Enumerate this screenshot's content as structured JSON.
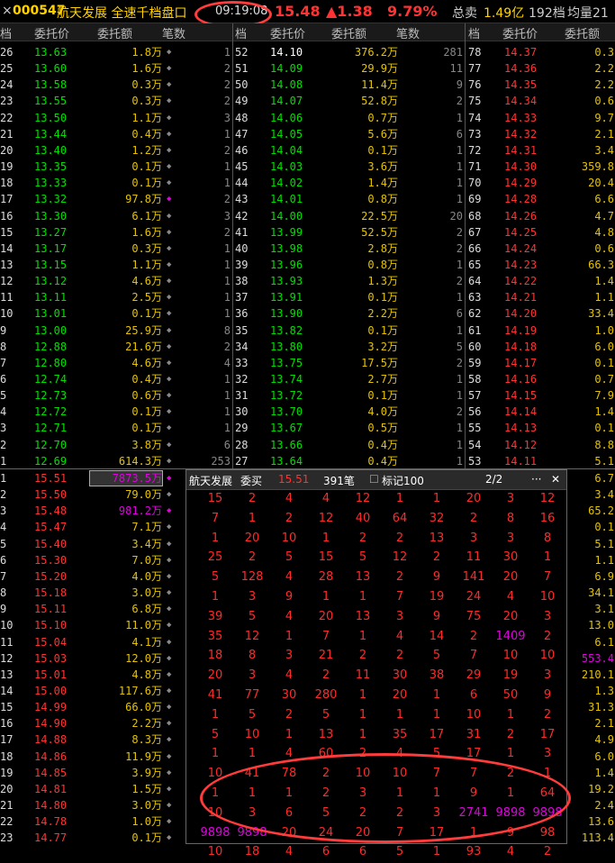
{
  "title": {
    "close": "×",
    "code": "000547",
    "name": "航天发展 全速千档盘口",
    "time": "09:19:08",
    "price": "15.48",
    "change": "▲1.38",
    "pct": "9.79%",
    "turnover_label": "总卖",
    "turnover_value": "1.49亿",
    "levels": "192档",
    "avg_label": "均量21"
  },
  "colors": {
    "up": "#ff3333",
    "down": "#00e000",
    "amount": "#e6c300",
    "flat": "#ffffff",
    "magenta": "#e000e0"
  },
  "header": [
    "档",
    "委托价",
    "委托额",
    "笔数",
    "档",
    "委托价",
    "委托额",
    "笔数",
    "档",
    "委托价",
    "委托额"
  ],
  "sell_left": [
    [
      "26",
      "13.63",
      "1.8万",
      "1"
    ],
    [
      "25",
      "13.60",
      "1.6万",
      "2"
    ],
    [
      "24",
      "13.58",
      "0.3万",
      "2"
    ],
    [
      "23",
      "13.55",
      "0.3万",
      "2"
    ],
    [
      "22",
      "13.50",
      "1.1万",
      "3"
    ],
    [
      "21",
      "13.44",
      "0.4万",
      "1"
    ],
    [
      "20",
      "13.40",
      "1.2万",
      "2"
    ],
    [
      "19",
      "13.35",
      "0.1万",
      "1"
    ],
    [
      "18",
      "13.33",
      "0.1万",
      "1"
    ],
    [
      "17",
      "13.32",
      "97.8万",
      "2"
    ],
    [
      "16",
      "13.30",
      "6.1万",
      "3"
    ],
    [
      "15",
      "13.27",
      "1.6万",
      "2"
    ],
    [
      "14",
      "13.17",
      "0.3万",
      "1"
    ],
    [
      "13",
      "13.15",
      "1.1万",
      "1"
    ],
    [
      "12",
      "13.12",
      "4.6万",
      "1"
    ],
    [
      "11",
      "13.11",
      "2.5万",
      "1"
    ],
    [
      "10",
      "13.01",
      "0.1万",
      "1"
    ],
    [
      "9",
      "13.00",
      "25.9万",
      "8"
    ],
    [
      "8",
      "12.88",
      "21.6万",
      "2"
    ],
    [
      "7",
      "12.80",
      "4.6万",
      "4"
    ],
    [
      "6",
      "12.74",
      "0.4万",
      "1"
    ],
    [
      "5",
      "12.73",
      "0.6万",
      "1"
    ],
    [
      "4",
      "12.72",
      "0.1万",
      "1"
    ],
    [
      "3",
      "12.71",
      "0.1万",
      "1"
    ],
    [
      "2",
      "12.70",
      "3.8万",
      "6"
    ],
    [
      "1",
      "12.69",
      "614.3万",
      "253"
    ]
  ],
  "sell_mid": [
    [
      "52",
      "14.10",
      "376.2万",
      "281"
    ],
    [
      "51",
      "14.09",
      "29.9万",
      "11"
    ],
    [
      "50",
      "14.08",
      "11.4万",
      "9"
    ],
    [
      "49",
      "14.07",
      "52.8万",
      "2"
    ],
    [
      "48",
      "14.06",
      "0.7万",
      "1"
    ],
    [
      "47",
      "14.05",
      "5.6万",
      "6"
    ],
    [
      "46",
      "14.04",
      "0.1万",
      "1"
    ],
    [
      "45",
      "14.03",
      "3.6万",
      "1"
    ],
    [
      "44",
      "14.02",
      "1.4万",
      "1"
    ],
    [
      "43",
      "14.01",
      "0.8万",
      "1"
    ],
    [
      "42",
      "14.00",
      "22.5万",
      "20"
    ],
    [
      "41",
      "13.99",
      "52.5万",
      "2"
    ],
    [
      "40",
      "13.98",
      "2.8万",
      "2"
    ],
    [
      "39",
      "13.96",
      "0.8万",
      "1"
    ],
    [
      "38",
      "13.93",
      "1.3万",
      "2"
    ],
    [
      "37",
      "13.91",
      "0.1万",
      "1"
    ],
    [
      "36",
      "13.90",
      "2.2万",
      "6"
    ],
    [
      "35",
      "13.82",
      "0.1万",
      "1"
    ],
    [
      "34",
      "13.80",
      "3.2万",
      "5"
    ],
    [
      "33",
      "13.75",
      "17.5万",
      "2"
    ],
    [
      "32",
      "13.74",
      "2.7万",
      "1"
    ],
    [
      "31",
      "13.72",
      "0.1万",
      "1"
    ],
    [
      "30",
      "13.70",
      "4.0万",
      "2"
    ],
    [
      "29",
      "13.67",
      "0.5万",
      "1"
    ],
    [
      "28",
      "13.66",
      "0.4万",
      "1"
    ],
    [
      "27",
      "13.64",
      "0.4万",
      "1"
    ]
  ],
  "sell_right": [
    [
      "78",
      "14.37",
      "0.3"
    ],
    [
      "77",
      "14.36",
      "2.2"
    ],
    [
      "76",
      "14.35",
      "2.2"
    ],
    [
      "75",
      "14.34",
      "0.6"
    ],
    [
      "74",
      "14.33",
      "9.7"
    ],
    [
      "73",
      "14.32",
      "2.1"
    ],
    [
      "72",
      "14.31",
      "3.4"
    ],
    [
      "71",
      "14.30",
      "359.8"
    ],
    [
      "70",
      "14.29",
      "20.4"
    ],
    [
      "69",
      "14.28",
      "6.6"
    ],
    [
      "68",
      "14.26",
      "4.7"
    ],
    [
      "67",
      "14.25",
      "4.8"
    ],
    [
      "66",
      "14.24",
      "0.6"
    ],
    [
      "65",
      "14.23",
      "66.3"
    ],
    [
      "64",
      "14.22",
      "1.4"
    ],
    [
      "63",
      "14.21",
      "1.1"
    ],
    [
      "62",
      "14.20",
      "33.4"
    ],
    [
      "61",
      "14.19",
      "1.0"
    ],
    [
      "60",
      "14.18",
      "6.0"
    ],
    [
      "59",
      "14.17",
      "0.1"
    ],
    [
      "58",
      "14.16",
      "0.7"
    ],
    [
      "57",
      "14.15",
      "7.9"
    ],
    [
      "56",
      "14.14",
      "1.4"
    ],
    [
      "55",
      "14.13",
      "0.1"
    ],
    [
      "54",
      "14.12",
      "8.8"
    ],
    [
      "53",
      "14.11",
      "5.1"
    ]
  ],
  "buy_left": [
    [
      "1",
      "15.51",
      "7873.5万"
    ],
    [
      "2",
      "15.50",
      "79.0万"
    ],
    [
      "3",
      "15.48",
      "981.2万"
    ],
    [
      "4",
      "15.47",
      "7.1万"
    ],
    [
      "5",
      "15.40",
      "3.4万"
    ],
    [
      "6",
      "15.30",
      "7.0万"
    ],
    [
      "7",
      "15.20",
      "4.0万"
    ],
    [
      "8",
      "15.18",
      "3.0万"
    ],
    [
      "9",
      "15.11",
      "6.8万"
    ],
    [
      "10",
      "15.10",
      "11.0万"
    ],
    [
      "11",
      "15.04",
      "4.1万"
    ],
    [
      "12",
      "15.03",
      "12.0万"
    ],
    [
      "13",
      "15.01",
      "4.8万"
    ],
    [
      "14",
      "15.00",
      "117.6万"
    ],
    [
      "15",
      "14.99",
      "66.0万"
    ],
    [
      "16",
      "14.90",
      "2.2万"
    ],
    [
      "17",
      "14.88",
      "8.3万"
    ],
    [
      "18",
      "14.86",
      "11.9万"
    ],
    [
      "19",
      "14.85",
      "3.9万"
    ],
    [
      "20",
      "14.81",
      "1.5万"
    ],
    [
      "21",
      "14.80",
      "3.0万"
    ],
    [
      "22",
      "14.78",
      "1.0万"
    ],
    [
      "23",
      "14.77",
      "0.1万"
    ]
  ],
  "buy_right": [
    "6.7",
    "3.4",
    "65.2",
    "0.1",
    "5.1",
    "1.1",
    "6.9",
    "34.1",
    "3.1",
    "13.0",
    "6.1",
    "553.4",
    "210.1",
    "1.3",
    "31.3",
    "2.1",
    "4.9",
    "6.0",
    "1.4",
    "19.2",
    "2.4",
    "13.6",
    "113.4"
  ],
  "popup": {
    "name": "航天发展",
    "mode": "委买",
    "price": "15.51",
    "count": "391笔",
    "mark": "标记100",
    "page": "2/2",
    "menu": "···",
    "close": "✕",
    "rows": [
      [
        "15",
        "2",
        "4",
        "4",
        "12",
        "1",
        "1",
        "20",
        "3",
        "12"
      ],
      [
        "7",
        "1",
        "2",
        "12",
        "40",
        "64",
        "32",
        "2",
        "8",
        "16"
      ],
      [
        "1",
        "20",
        "10",
        "1",
        "2",
        "2",
        "13",
        "3",
        "3",
        "8"
      ],
      [
        "25",
        "2",
        "5",
        "15",
        "5",
        "12",
        "2",
        "11",
        "30",
        "1"
      ],
      [
        "5",
        "128",
        "4",
        "28",
        "13",
        "2",
        "9",
        "141",
        "20",
        "7"
      ],
      [
        "1",
        "3",
        "9",
        "1",
        "1",
        "7",
        "19",
        "24",
        "4",
        "10"
      ],
      [
        "39",
        "5",
        "4",
        "20",
        "13",
        "3",
        "9",
        "75",
        "20",
        "3"
      ],
      [
        "35",
        "12",
        "1",
        "7",
        "1",
        "4",
        "14",
        "2",
        "1409",
        "2"
      ],
      [
        "18",
        "8",
        "3",
        "21",
        "2",
        "2",
        "5",
        "7",
        "10",
        "10"
      ],
      [
        "20",
        "3",
        "4",
        "2",
        "11",
        "30",
        "38",
        "29",
        "19",
        "3"
      ],
      [
        "41",
        "77",
        "30",
        "280",
        "1",
        "20",
        "1",
        "6",
        "50",
        "9"
      ],
      [
        "1",
        "5",
        "2",
        "5",
        "1",
        "1",
        "1",
        "10",
        "1",
        "2"
      ],
      [
        "5",
        "10",
        "1",
        "13",
        "1",
        "35",
        "17",
        "31",
        "2",
        "17"
      ],
      [
        "1",
        "1",
        "4",
        "60",
        "2",
        "4",
        "5",
        "17",
        "1",
        "3"
      ],
      [
        "10",
        "41",
        "78",
        "2",
        "10",
        "10",
        "7",
        "7",
        "2",
        "1"
      ],
      [
        "1",
        "1",
        "1",
        "2",
        "3",
        "1",
        "1",
        "9",
        "1",
        "64"
      ],
      [
        "10",
        "3",
        "6",
        "5",
        "2",
        "2",
        "3",
        "2741",
        "9898",
        "9898"
      ],
      [
        "9898",
        "9898",
        "20",
        "24",
        "20",
        "7",
        "17",
        "1",
        "9",
        "98"
      ],
      [
        "10",
        "18",
        "4",
        "6",
        "6",
        "5",
        "1",
        "93",
        "4",
        "2"
      ]
    ],
    "highlights": [
      "1409",
      "2741",
      "9898"
    ]
  }
}
